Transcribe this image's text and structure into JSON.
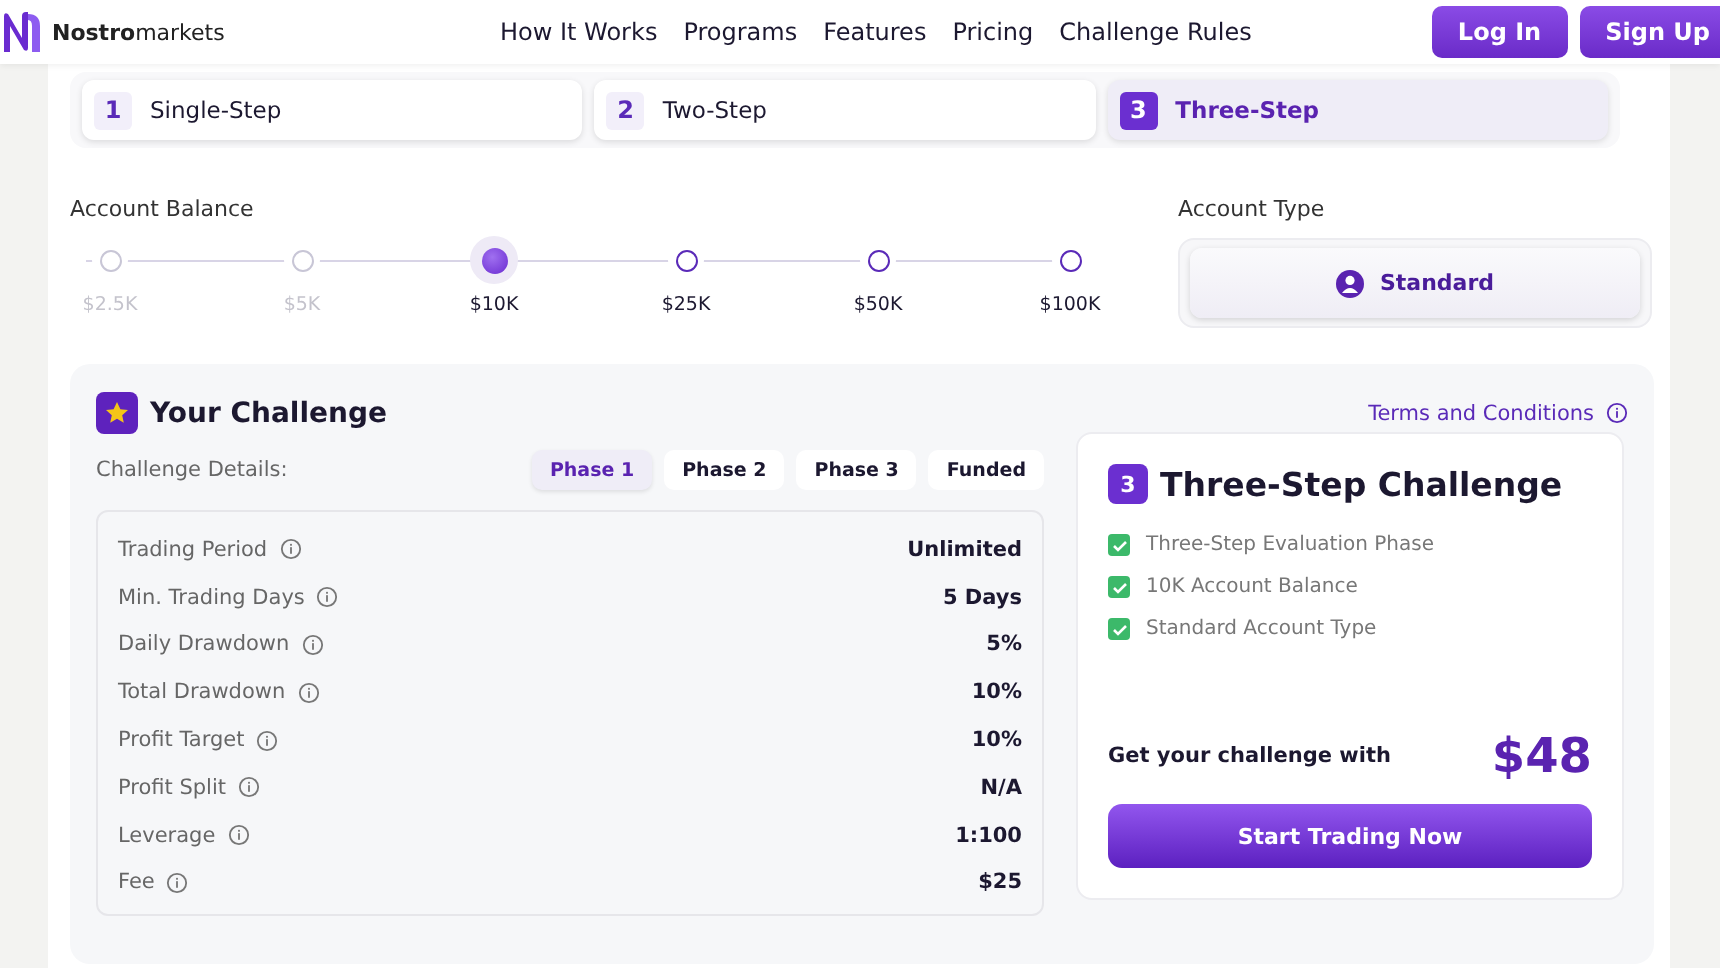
{
  "header": {
    "brand_bold": "Nostro",
    "brand_rest": "markets",
    "nav": [
      "How It Works",
      "Programs",
      "Features",
      "Pricing",
      "Challenge Rules"
    ],
    "buttons": [
      "Log In",
      "Sign Up"
    ]
  },
  "steps": [
    {
      "number": "1",
      "label": "Single-Step",
      "selected": false
    },
    {
      "number": "2",
      "label": "Two-Step",
      "selected": false
    },
    {
      "number": "3",
      "label": "Three-Step",
      "selected": true
    }
  ],
  "account_balance": {
    "label": "Account Balance",
    "options": [
      {
        "label": "$2.5K",
        "selected": false,
        "disabled": true
      },
      {
        "label": "$5K",
        "selected": false,
        "disabled": true
      },
      {
        "label": "$10K",
        "selected": true,
        "disabled": false
      },
      {
        "label": "$25K",
        "selected": false,
        "disabled": false
      },
      {
        "label": "$50K",
        "selected": false,
        "disabled": false
      },
      {
        "label": "$100K",
        "selected": false,
        "disabled": false
      }
    ]
  },
  "account_type": {
    "label": "Account Type",
    "options": [
      {
        "label": "Standard",
        "selected": true
      }
    ]
  },
  "challenge": {
    "title": "Your Challenge",
    "terms_link": "Terms and Conditions",
    "details_label": "Challenge Details:",
    "phases": [
      {
        "label": "Phase 1",
        "selected": true
      },
      {
        "label": "Phase 2",
        "selected": false
      },
      {
        "label": "Phase 3",
        "selected": false
      },
      {
        "label": "Funded",
        "selected": false
      }
    ],
    "rows": [
      {
        "label": "Trading Period",
        "value": "Unlimited"
      },
      {
        "label": "Min. Trading Days",
        "value": "5 Days"
      },
      {
        "label": "Daily Drawdown",
        "value": "5%"
      },
      {
        "label": "Total Drawdown",
        "value": "10%"
      },
      {
        "label": "Profit Target",
        "value": "10%"
      },
      {
        "label": "Profit Split",
        "value": "N/A"
      },
      {
        "label": "Leverage",
        "value": "1:100"
      },
      {
        "label": "Fee",
        "value": "$25"
      }
    ],
    "summary": {
      "number": "3",
      "title": "Three-Step Challenge",
      "features": [
        {
          "label": "Three-Step Evaluation Phase",
          "checked": true
        },
        {
          "label": "10K Account Balance",
          "checked": true
        },
        {
          "label": "Standard Account Type",
          "checked": true
        }
      ],
      "price_label": "Get your challenge with",
      "price": "$48",
      "button": "Start Trading Now"
    }
  }
}
